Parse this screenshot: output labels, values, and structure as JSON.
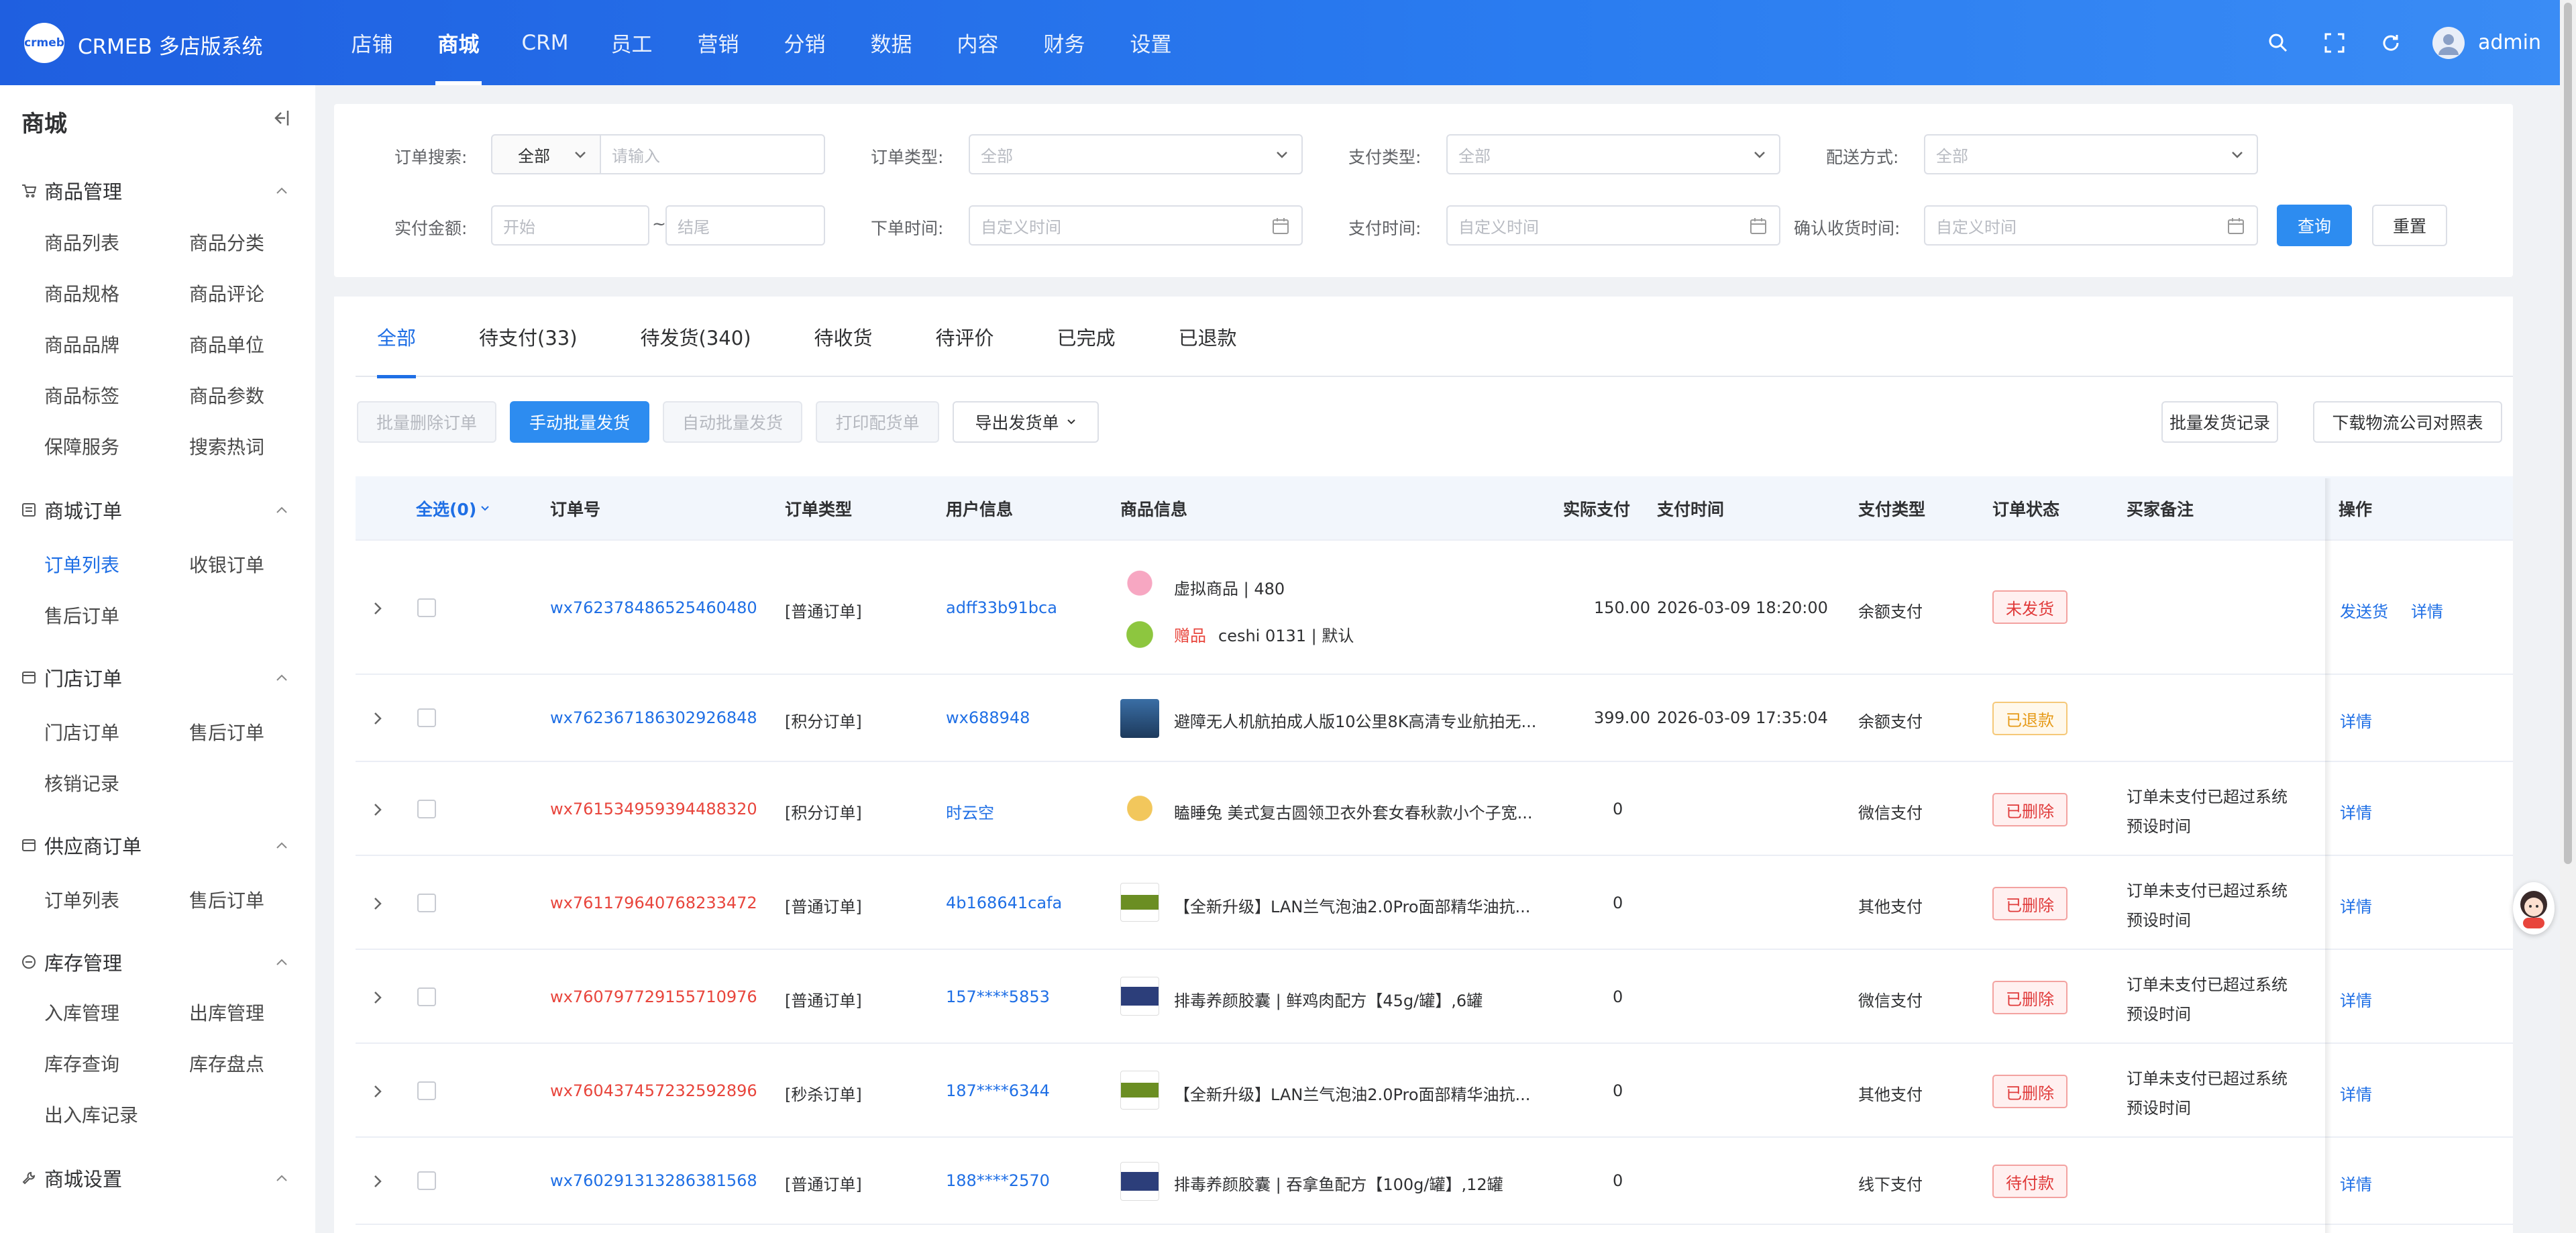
{
  "brand": {
    "logo_text": "crmeb",
    "name": "CRMEB 多店版系统"
  },
  "nav": [
    "店铺",
    "商城",
    "CRM",
    "员工",
    "营销",
    "分销",
    "数据",
    "内容",
    "财务",
    "设置"
  ],
  "nav_active_index": 1,
  "user": {
    "name": "admin"
  },
  "header_icons": [
    "search-icon",
    "fullscreen-icon",
    "refresh-icon"
  ],
  "sidebar": {
    "title": "商城",
    "groups": [
      {
        "label": "商品管理",
        "icon": "cart-icon",
        "items": [
          "商品列表",
          "商品分类",
          "商品规格",
          "商品评论",
          "商品品牌",
          "商品单位",
          "商品标签",
          "商品参数",
          "保障服务",
          "搜索热词"
        ]
      },
      {
        "label": "商城订单",
        "icon": "list-icon",
        "items": [
          "订单列表",
          "收银订单",
          "售后订单"
        ]
      },
      {
        "label": "门店订单",
        "icon": "store-icon",
        "items": [
          "门店订单",
          "售后订单",
          "核销记录"
        ]
      },
      {
        "label": "供应商订单",
        "icon": "store-icon",
        "items": [
          "订单列表",
          "售后订单"
        ]
      },
      {
        "label": "库存管理",
        "icon": "box-icon",
        "items": [
          "入库管理",
          "出库管理",
          "库存查询",
          "库存盘点",
          "出入库记录"
        ]
      },
      {
        "label": "商城设置",
        "icon": "wrench-icon",
        "items": []
      }
    ],
    "active_item": "订单列表"
  },
  "filters": {
    "order_search_label": "订单搜索:",
    "order_search_select": "全部",
    "order_search_placeholder": "请输入",
    "order_type_label": "订单类型:",
    "order_type_value": "全部",
    "pay_type_label": "支付类型:",
    "pay_type_value": "全部",
    "delivery_label": "配送方式:",
    "delivery_value": "全部",
    "paid_amount_label": "实付金额:",
    "amount_start": "开始",
    "amount_sep": "~",
    "amount_end": "结尾",
    "order_time_label": "下单时间:",
    "order_time_placeholder": "自定义时间",
    "pay_time_label": "支付时间:",
    "pay_time_placeholder": "自定义时间",
    "confirm_time_label": "确认收货时间:",
    "confirm_time_placeholder": "自定义时间",
    "query_button": "查询",
    "reset_button": "重置"
  },
  "tabs": [
    "全部",
    "待支付(33)",
    "待发货(340)",
    "待收货",
    "待评价",
    "已完成",
    "已退款"
  ],
  "active_tab": 0,
  "actions": {
    "batch_delete": "批量删除订单",
    "manual_ship": "手动批量发货",
    "auto_ship": "自动批量发货",
    "print": "打印配货单",
    "export": "导出发货单",
    "ship_record": "批量发货记录",
    "download_logistics": "下载物流公司对照表"
  },
  "table": {
    "headers": {
      "select_all": "全选(0)",
      "order_no": "订单号",
      "order_type": "订单类型",
      "user": "用户信息",
      "product": "商品信息",
      "paid": "实际支付",
      "pay_time": "支付时间",
      "pay_type": "支付类型",
      "status": "订单状态",
      "remark": "买家备注",
      "ops": "操作"
    },
    "rows": [
      {
        "order_no": "wx762378486525460480",
        "order_no_color": "link",
        "type": "[普通订单]",
        "user": "adff33b91bca",
        "products": [
          {
            "text": "虚拟商品 | 480",
            "gift": ""
          },
          {
            "text": "ceshi 0131 | 默认",
            "gift": "赠品"
          }
        ],
        "paid": "150.00",
        "pay_time": "2026-03-09 18:20:00",
        "pay_type": "余额支付",
        "status": "未发货",
        "status_style": "red",
        "remark": "",
        "ops": [
          "发送货",
          "详情"
        ]
      },
      {
        "order_no": "wx762367186302926848",
        "order_no_color": "link",
        "type": "[积分订单]",
        "user": "wx688948",
        "products": [
          {
            "text": "避障无人机航拍成人版10公里8K高清专业航拍无...",
            "gift": ""
          }
        ],
        "paid": "399.00",
        "pay_time": "2026-03-09 17:35:04",
        "pay_type": "余额支付",
        "status": "已退款",
        "status_style": "yellow",
        "remark": "",
        "ops": [
          "详情"
        ]
      },
      {
        "order_no": "wx761534959394488320",
        "order_no_color": "red",
        "type": "[积分订单]",
        "user": "时云空",
        "products": [
          {
            "text": "瞌睡兔 美式复古圆领卫衣外套女春秋款小个子宽...",
            "gift": ""
          }
        ],
        "paid": "0",
        "pay_time": "",
        "pay_type": "微信支付",
        "status": "已删除",
        "status_style": "red",
        "remark": "订单未支付已超过系统预设时间",
        "ops": [
          "详情"
        ]
      },
      {
        "order_no": "wx761179640768233472",
        "order_no_color": "red",
        "type": "[普通订单]",
        "user": "4b168641cafa",
        "products": [
          {
            "text": "【全新升级】LAN兰气泡油2.0Pro面部精华油抗...",
            "gift": ""
          }
        ],
        "paid": "0",
        "pay_time": "",
        "pay_type": "其他支付",
        "status": "已删除",
        "status_style": "red",
        "remark": "订单未支付已超过系统预设时间",
        "ops": [
          "详情"
        ]
      },
      {
        "order_no": "wx760797729155710976",
        "order_no_color": "red",
        "type": "[普通订单]",
        "user": "157****5853",
        "products": [
          {
            "text": "排毒养颜胶囊 | 鲜鸡肉配方【45g/罐】,6罐",
            "gift": ""
          }
        ],
        "paid": "0",
        "pay_time": "",
        "pay_type": "微信支付",
        "status": "已删除",
        "status_style": "red",
        "remark": "订单未支付已超过系统预设时间",
        "ops": [
          "详情"
        ]
      },
      {
        "order_no": "wx760437457232592896",
        "order_no_color": "red",
        "type": "[秒杀订单]",
        "user": "187****6344",
        "products": [
          {
            "text": "【全新升级】LAN兰气泡油2.0Pro面部精华油抗...",
            "gift": ""
          }
        ],
        "paid": "0",
        "pay_time": "",
        "pay_type": "其他支付",
        "status": "已删除",
        "status_style": "red",
        "remark": "订单未支付已超过系统预设时间",
        "ops": [
          "详情"
        ]
      },
      {
        "order_no": "wx760291313286381568",
        "order_no_color": "link",
        "type": "[普通订单]",
        "user": "188****2570",
        "products": [
          {
            "text": "排毒养颜胶囊 | 吞拿鱼配方【100g/罐】,12罐",
            "gift": ""
          }
        ],
        "paid": "0",
        "pay_time": "",
        "pay_type": "线下支付",
        "status": "待付款",
        "status_style": "red",
        "remark": "",
        "ops": [
          "详情"
        ]
      }
    ]
  },
  "colors": {
    "primary": "#2d8cf0",
    "header_start": "#1f5fe0",
    "danger": "#e8453c",
    "warning": "#e69a18",
    "link": "#1f6fe5"
  }
}
